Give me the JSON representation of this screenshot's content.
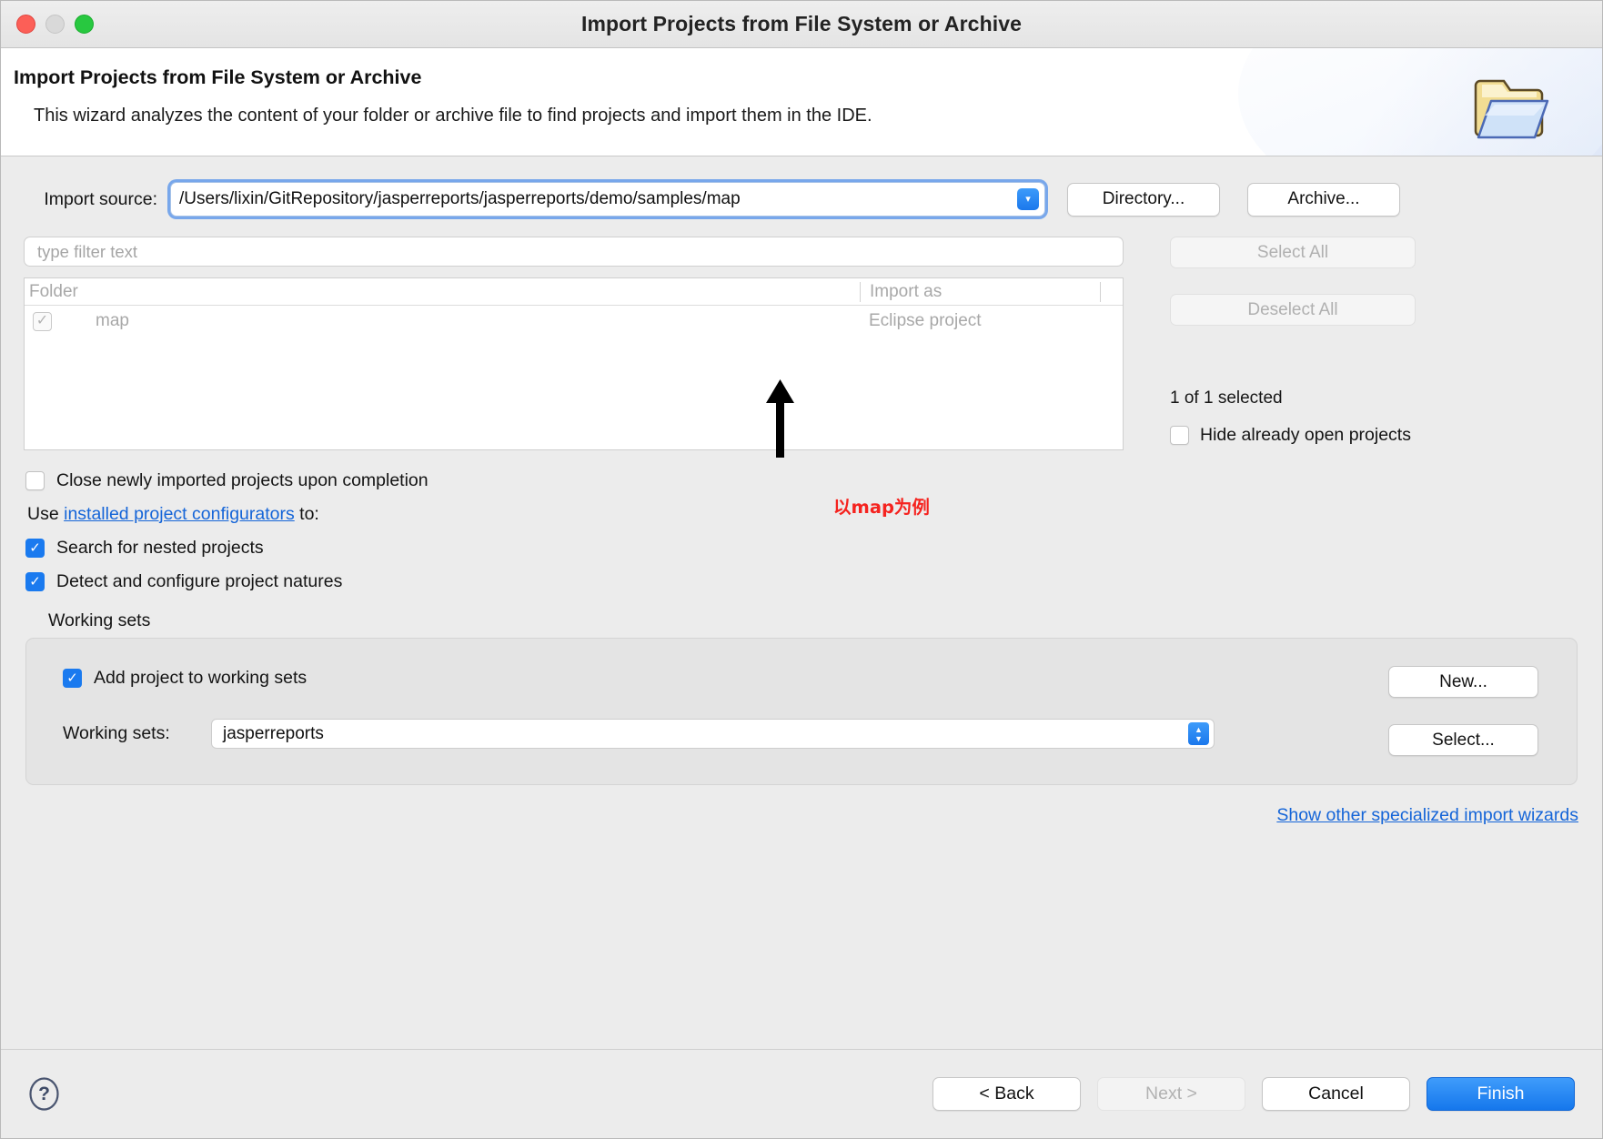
{
  "window": {
    "title": "Import Projects from File System or Archive",
    "traffic_lights": [
      "close",
      "minimize",
      "maximize"
    ]
  },
  "banner": {
    "title": "Import Projects from File System or Archive",
    "description": "This wizard analyzes the content of your folder or archive file to find projects and import them in the IDE.",
    "icon": "open-folder-icon"
  },
  "source": {
    "label": "Import source:",
    "value": "/Users/lixin/GitRepository/jasperreports/jasperreports/demo/samples/map",
    "directory_button": "Directory...",
    "archive_button": "Archive..."
  },
  "filter": {
    "placeholder": "type filter text",
    "value": ""
  },
  "table": {
    "columns": [
      "Folder",
      "Import as"
    ],
    "rows": [
      {
        "checked": true,
        "folder": "map",
        "import_as": "Eclipse project"
      }
    ]
  },
  "annotation": {
    "text": "以map为例",
    "color": "#f5231f"
  },
  "side": {
    "select_all": "Select All",
    "deselect_all": "Deselect All",
    "selected_count": "1 of 1 selected",
    "hide_open_projects": "Hide already open projects"
  },
  "options": {
    "close_imported": "Close newly imported projects upon completion",
    "use_prefix": "Use ",
    "configurators_link": "installed project configurators",
    "use_suffix": " to:",
    "search_nested": "Search for nested projects",
    "detect_natures": "Detect and configure project natures"
  },
  "working_sets": {
    "legend": "Working sets",
    "add_label": "Add project to working sets",
    "select_label": "Working sets:",
    "selected": "jasperreports",
    "new_button": "New...",
    "select_button": "Select..."
  },
  "wizards_link": "Show other specialized import wizards",
  "footer": {
    "help": "?",
    "back": "< Back",
    "next": "Next >",
    "cancel": "Cancel",
    "finish": "Finish"
  },
  "colors": {
    "accent": "#1a7aef",
    "link": "#1565d8",
    "annotation": "#f5231f",
    "window_bg": "#ececec"
  }
}
